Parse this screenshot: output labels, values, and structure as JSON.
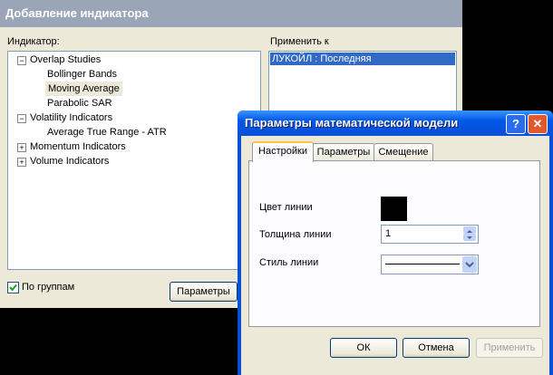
{
  "main_window": {
    "title": "Добавление индикатора",
    "indicator_label": "Индикатор:",
    "apply_to_label": "Применить к",
    "tree": [
      {
        "label": "Overlap Studies",
        "expander": "−"
      },
      {
        "label": "Bollinger Bands"
      },
      {
        "label": "Moving Average",
        "selected": true
      },
      {
        "label": "Parabolic SAR"
      },
      {
        "label": "Volatility Indicators",
        "expander": "−"
      },
      {
        "label": "Average True Range - ATR"
      },
      {
        "label": "Momentum Indicators",
        "expander": "+"
      },
      {
        "label": "Volume Indicators",
        "expander": "+"
      }
    ],
    "apply_list": [
      "ЛУКОЙЛ : Последняя"
    ],
    "group_checkbox": {
      "label": "По группам",
      "checked": true
    },
    "params_button": "Параметры"
  },
  "dialog": {
    "title": "Параметры математической модели",
    "help_button": "?",
    "close_button": "✕",
    "tabs": [
      "Настройки",
      "Параметры",
      "Смещение"
    ],
    "active_tab": "Настройки",
    "settings": {
      "line_color_label": "Цвет линии",
      "line_color": "#000000",
      "line_width_label": "Толщина линии",
      "line_width_value": "1",
      "line_style_label": "Стиль линии"
    },
    "buttons": {
      "ok": "ОК",
      "cancel": "Отмена",
      "apply": "Применить"
    }
  }
}
